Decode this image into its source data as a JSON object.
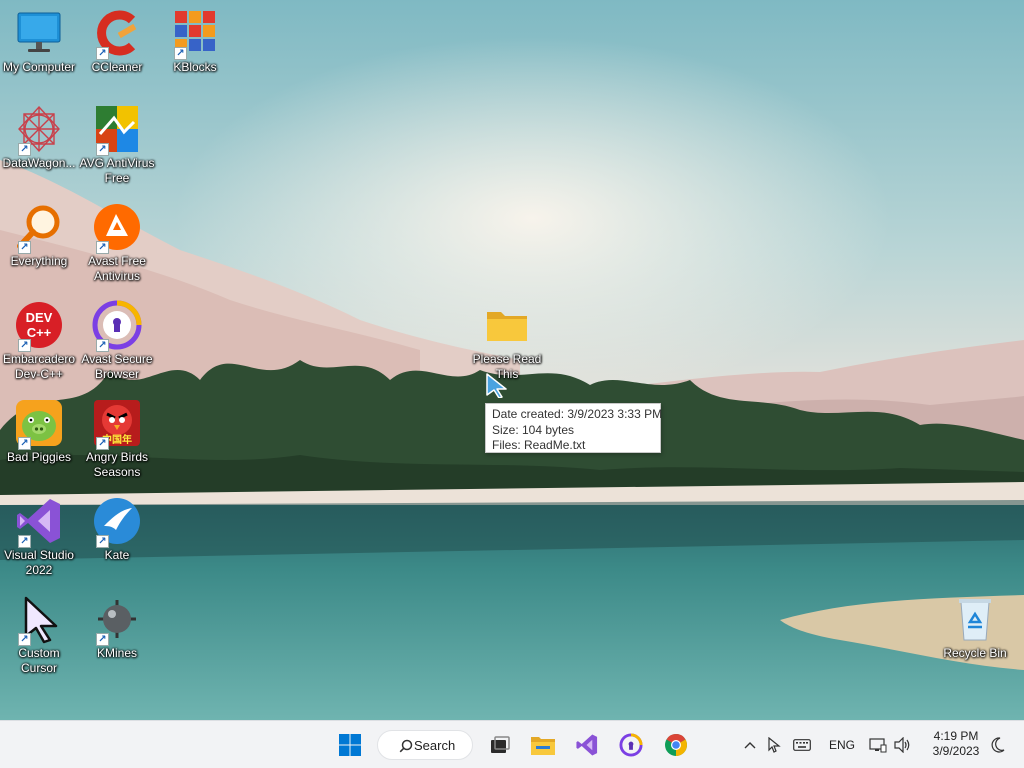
{
  "desktop": {
    "icons": [
      {
        "label": "My Computer"
      },
      {
        "label": "CCleaner"
      },
      {
        "label": "KBlocks"
      },
      {
        "label": "DataWagon..."
      },
      {
        "label": "AVG AntiVirus Free"
      },
      {
        "label": "Everything"
      },
      {
        "label": "Avast Free Antivirus"
      },
      {
        "label": "Embarcadero Dev-C++"
      },
      {
        "label": "Avast Secure Browser"
      },
      {
        "label": "Bad Piggies"
      },
      {
        "label": "Angry Birds Seasons"
      },
      {
        "label": "Visual Studio 2022"
      },
      {
        "label": "Kate"
      },
      {
        "label": "Custom Cursor"
      },
      {
        "label": "KMines"
      },
      {
        "label": "Please Read This"
      },
      {
        "label": "Recycle Bin"
      }
    ],
    "devcpp_text": "DEV\nC++",
    "angrybirds_text": "中国年"
  },
  "tooltip": {
    "date_created": "Date created: 3/9/2023 3:33 PM",
    "size": "Size: 104 bytes",
    "files": "Files: ReadMe.txt"
  },
  "taskbar": {
    "search_label": "Search",
    "language": "ENG",
    "time": "4:19 PM",
    "date": "3/9/2023"
  },
  "colors": {
    "taskbar_bg": "#f2f3f5",
    "windows_blue": "#0078d4",
    "folder_yellow": "#f8c83c"
  }
}
